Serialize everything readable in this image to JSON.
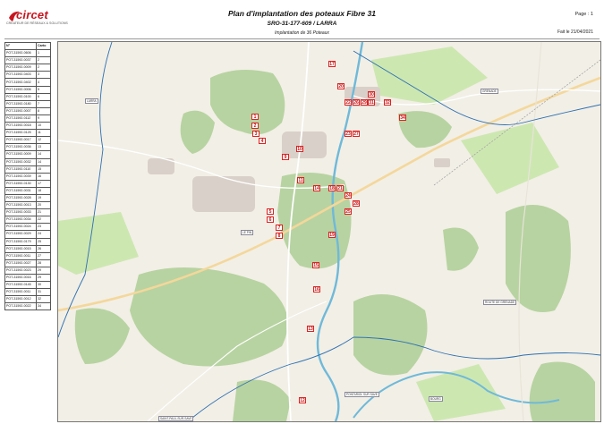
{
  "header": {
    "logo_text": "circet",
    "logo_tagline": "CRÉATEUR DE RÉSEAUX & SOLUTIONS",
    "title": "Plan d'implantation des poteaux Fibre 31",
    "subtitle": "SRO-31-177-609 / LARRA",
    "subsubtitle": "Implantation de 36 Poteaux",
    "page": "Page : 1",
    "date": "Fait le 21/04/2021"
  },
  "legend": {
    "col_id": "N°",
    "col_num": "Carto",
    "rows": [
      [
        "POT-31592-0606",
        "1"
      ],
      [
        "POT-31592-0037",
        "2"
      ],
      [
        "POT-31592-0009",
        "2"
      ],
      [
        "POT-31592-0403",
        "3"
      ],
      [
        "POT-31592-0402",
        "4"
      ],
      [
        "POT-31592-0006",
        "5"
      ],
      [
        "POT-31592-0100",
        "6"
      ],
      [
        "POT-31592-0180",
        "7"
      ],
      [
        "POT-31592-0007",
        "8"
      ],
      [
        "POT-31592-0112",
        "9"
      ],
      [
        "POT-31592-0018",
        "10"
      ],
      [
        "POT-31592-0125",
        "11"
      ],
      [
        "POT-31592-0017",
        "12"
      ],
      [
        "POT-31592-0036",
        "13"
      ],
      [
        "POT-31592-0009",
        "14"
      ],
      [
        "POT-31592-0032",
        "14"
      ],
      [
        "POT-31592-0110",
        "15"
      ],
      [
        "POT-31592-0039",
        "16"
      ],
      [
        "POT-31592-0130",
        "17"
      ],
      [
        "POT-31592-0031",
        "18"
      ],
      [
        "POT-31592-0028",
        "19"
      ],
      [
        "POT-31592-0013",
        "20"
      ],
      [
        "POT-31592-0033",
        "21"
      ],
      [
        "POT-31592-0034",
        "22"
      ],
      [
        "POT-31592-0024",
        "23"
      ],
      [
        "POT-31592-0029",
        "24"
      ],
      [
        "POT-31592-0179",
        "25"
      ],
      [
        "POT-31592-0015",
        "26"
      ],
      [
        "POT-31592-0011",
        "27"
      ],
      [
        "POT-31592-0027",
        "28"
      ],
      [
        "POT-31592-0023",
        "29"
      ],
      [
        "POT-31592-0016",
        "29"
      ],
      [
        "POT-31592-0145",
        "30"
      ],
      [
        "POT-31592-0011",
        "31"
      ],
      [
        "POT-31592-0012",
        "32"
      ],
      [
        "POT-31592-0022",
        "34"
      ]
    ]
  },
  "map": {
    "colors": {
      "base": "#f2efe6",
      "forest": "#b7d3a1",
      "meadow": "#cde7b1",
      "water": "#6fb9d9",
      "road": "#ffffff",
      "road_major": "#f4d79b",
      "building": "#d9d0c9",
      "pole": "#dd2222",
      "boundary": "#2c6fb3"
    },
    "poles": [
      {
        "n": "1"
      },
      {
        "n": "2"
      },
      {
        "n": "3"
      },
      {
        "n": "4"
      },
      {
        "n": "5"
      },
      {
        "n": "6"
      },
      {
        "n": "7"
      },
      {
        "n": "8"
      },
      {
        "n": "9"
      },
      {
        "n": "10"
      },
      {
        "n": "11"
      },
      {
        "n": "12"
      },
      {
        "n": "13"
      },
      {
        "n": "14"
      },
      {
        "n": "15"
      },
      {
        "n": "16"
      },
      {
        "n": "17"
      },
      {
        "n": "18"
      },
      {
        "n": "19"
      },
      {
        "n": "20"
      },
      {
        "n": "21"
      },
      {
        "n": "22"
      },
      {
        "n": "23"
      },
      {
        "n": "24"
      },
      {
        "n": "25"
      },
      {
        "n": "26"
      },
      {
        "n": "27"
      },
      {
        "n": "28"
      },
      {
        "n": "29"
      },
      {
        "n": "30"
      },
      {
        "n": "31"
      },
      {
        "n": "32"
      },
      {
        "n": "34"
      }
    ],
    "place_labels": [
      "LARRA",
      "GRENADE",
      "LE PIN",
      "ROUTE DE GRENADE",
      "SAINT-PAUL-SUR-SAVE",
      "PONTARIOL SUR SAVE",
      "BOURG"
    ]
  }
}
